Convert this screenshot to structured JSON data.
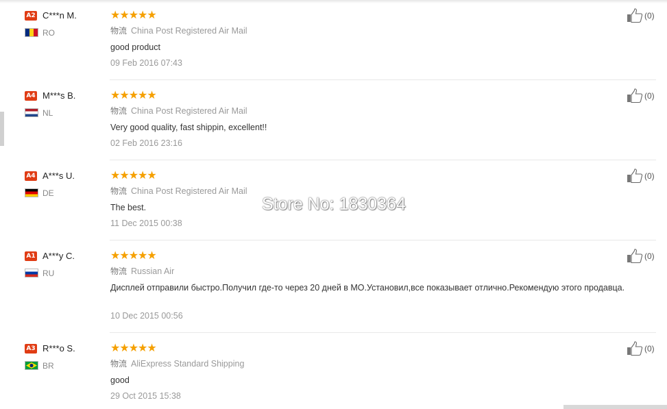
{
  "watermark": "Store No: 1830364",
  "logistics_tag": "物流",
  "reviews": [
    {
      "level": "A2",
      "name": "C***n M.",
      "country": "RO",
      "flag_colors": [
        "#002b7f",
        "#fcd116",
        "#ce1126"
      ],
      "flag_dir": "vertical",
      "stars": "★★★★★",
      "shipping": "China Post Registered Air Mail",
      "feedback": "good product",
      "date": "09 Feb 2016 07:43",
      "useful": "(0)"
    },
    {
      "level": "A4",
      "name": "M***s B.",
      "country": "NL",
      "flag_colors": [
        "#ae1c28",
        "#ffffff",
        "#21468b"
      ],
      "flag_dir": "horizontal",
      "stars": "★★★★★",
      "shipping": "China Post Registered Air Mail",
      "feedback": "Very good quality, fast shippin, excellent!!",
      "date": "02 Feb 2016 23:16",
      "useful": "(0)"
    },
    {
      "level": "A4",
      "name": "A***s U.",
      "country": "DE",
      "flag_colors": [
        "#000000",
        "#dd0000",
        "#ffce00"
      ],
      "flag_dir": "horizontal",
      "stars": "★★★★★",
      "shipping": "China Post Registered Air Mail",
      "feedback": "The best.",
      "date": "11 Dec 2015 00:38",
      "useful": "(0)"
    },
    {
      "level": "A1",
      "name": "A***y C.",
      "country": "RU",
      "flag_colors": [
        "#ffffff",
        "#0039a6",
        "#d52b1e"
      ],
      "flag_dir": "horizontal",
      "stars": "★★★★★",
      "shipping": "Russian Air",
      "feedback": "Дисплей отправили быстро.Получил где-то через 20 дней в МО.Установил,все показывает отлично.Рекомендую этого продавца.",
      "date": "10 Dec 2015 00:56",
      "useful": "(0)"
    },
    {
      "level": "A3",
      "name": "R***o S.",
      "country": "BR",
      "flag_colors": [
        "#009c3b",
        "#ffdf00",
        "#002776"
      ],
      "flag_dir": "brazil",
      "stars": "★★★★★",
      "shipping": "AliExpress Standard Shipping",
      "feedback": "good",
      "date": "29 Oct 2015 15:38",
      "useful": "(0)"
    }
  ]
}
